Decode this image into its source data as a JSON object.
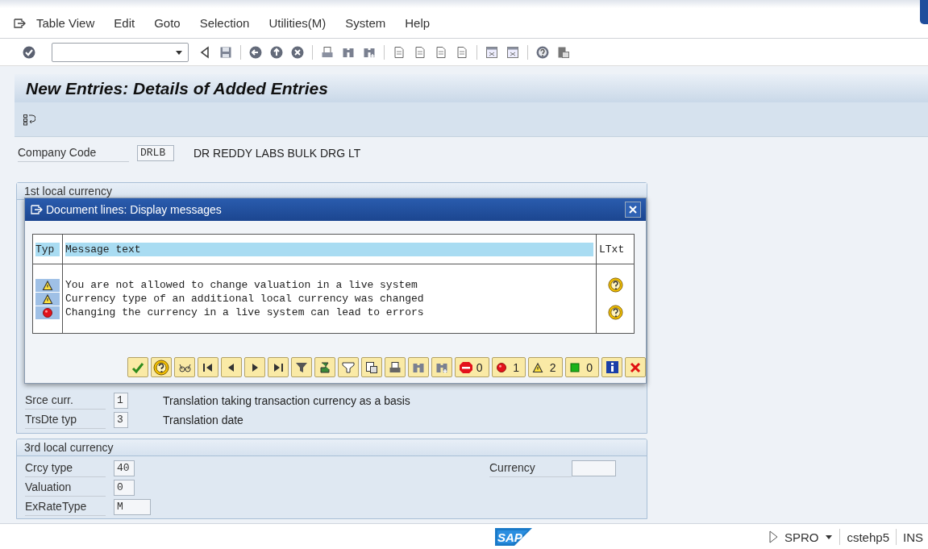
{
  "menu": [
    {
      "label": "Table View"
    },
    {
      "label": "Edit"
    },
    {
      "label": "Goto"
    },
    {
      "label": "Selection"
    },
    {
      "label": "Utilities(M)"
    },
    {
      "label": "System"
    },
    {
      "label": "Help"
    }
  ],
  "screen_title": "New Entries: Details of Added Entries",
  "company_code": {
    "label": "Company Code",
    "value": "DRLB",
    "description": "DR REDDY LABS BULK DRG LT"
  },
  "first_local_currency": {
    "title": "1st local currency",
    "fields": [
      {
        "label": "Srce curr.",
        "value": "1",
        "description": "Translation taking transaction currency as a basis"
      },
      {
        "label": "TrsDte typ",
        "value": "3",
        "description": "Translation date"
      }
    ]
  },
  "third_local_currency": {
    "title": "3rd local currency",
    "fields": [
      {
        "label": "Crcy type",
        "value": "40"
      },
      {
        "label": "Valuation",
        "value": "0"
      },
      {
        "label": "ExRateType",
        "value": "M"
      }
    ],
    "currency_label": "Currency"
  },
  "dialog": {
    "title": "Document lines: Display messages",
    "columns": [
      "Typ",
      "Message text",
      "LTxt"
    ],
    "rows": [
      {
        "kind": "warning",
        "text": "You are not allowed to change valuation in a live system",
        "long_text": true
      },
      {
        "kind": "warning",
        "text": "Currency type of an additional local currency was changed",
        "long_text": false
      },
      {
        "kind": "error",
        "text": "Changing the currency in a live system can lead to errors",
        "long_text": true
      }
    ],
    "counters": [
      {
        "kind": "stop",
        "count": "0"
      },
      {
        "kind": "error",
        "count": "1"
      },
      {
        "kind": "warning",
        "count": "2"
      },
      {
        "kind": "success",
        "count": "0"
      }
    ]
  },
  "status_bar": {
    "logo": "SAP",
    "transaction": "SPRO",
    "server": "cstehp5",
    "mode": "INS"
  }
}
